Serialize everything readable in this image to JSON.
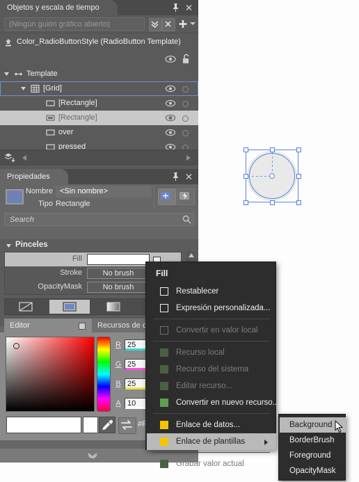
{
  "objects_panel": {
    "tab_label": "Objetos y escala de tiempo",
    "pin_icon": "pin-icon",
    "close_icon": "close-icon",
    "storyboard_field": "(Ningún guión gráfico abierto)",
    "storyboard_btn1": "collapse-all-icon",
    "storyboard_btn2": "close-storyboard-icon",
    "storyboard_plus": "plus-icon",
    "storyboard_caret": "chevron-down-icon",
    "root_label": "Color_RadioButtonStyle (RadioButton Template)",
    "root_icon": "return-scope-icon",
    "header_eye_icon": "eye-icon",
    "header_lock_icon": "unlock-icon",
    "tree": [
      {
        "label": "Template",
        "icon": "template-icon",
        "indent": 20,
        "caret": true,
        "selected": false,
        "outlined": false,
        "eye": false
      },
      {
        "label": "[Grid]",
        "icon": "grid-icon",
        "indent": 44,
        "caret": true,
        "selected": false,
        "outlined": true,
        "eye": true
      },
      {
        "label": "[Rectangle]",
        "icon": "rect-icon",
        "indent": 66,
        "caret": false,
        "selected": false,
        "outlined": false,
        "eye": true
      },
      {
        "label": "[Rectangle]",
        "icon": "rect-filled-icon",
        "indent": 66,
        "caret": false,
        "selected": true,
        "outlined": false,
        "eye": true
      },
      {
        "label": "over",
        "icon": "rect-icon",
        "indent": 66,
        "caret": false,
        "selected": false,
        "outlined": false,
        "eye": true
      },
      {
        "label": "pressed",
        "icon": "rect-icon",
        "indent": 66,
        "caret": false,
        "selected": false,
        "outlined": false,
        "eye": true
      }
    ],
    "bottom_icon": "layers-down-icon",
    "bottom_arrow_left": "arrow-left-icon",
    "bottom_arrow_right": "arrow-right-icon"
  },
  "properties_panel": {
    "tab_label": "Propiedades",
    "pin_icon": "pin-icon",
    "close_icon": "close-icon",
    "name_label": "Nombre",
    "name_value": "<Sin nombre>",
    "type_label": "Tipo",
    "type_value": "Rectangle",
    "thumb_name": "element-thumbnail",
    "btn_a": "show-properties-icon",
    "btn_b": "show-events-icon",
    "search_placeholder": "Search",
    "search_value": "Search",
    "search_icon": "search-icon"
  },
  "brushes": {
    "section_title": "Pinceles",
    "caret_icon": "chevron-down-icon",
    "rows": [
      {
        "label": "Fill",
        "value": "",
        "style": "white",
        "marker": "advanced-options-white",
        "highlighted": true
      },
      {
        "label": "Stroke",
        "value": "No brush",
        "style": "nobrush",
        "marker": "advanced-options",
        "highlighted": false
      },
      {
        "label": "OpacityMask",
        "value": "No brush",
        "style": "nobrush",
        "marker": "advanced-options-dim",
        "highlighted": false
      }
    ],
    "brush_tabs": [
      {
        "name": "no-brush-tab",
        "active": false
      },
      {
        "name": "solid-color-tab",
        "active": true
      },
      {
        "name": "gradient-brush-tab",
        "active": false
      },
      {
        "name": "tile-brush-tab",
        "active": false
      }
    ],
    "scroll_up_icon": "scroll-up-arrow"
  },
  "editor": {
    "tab_editor": "Editor",
    "tab_resources": "Recursos de c",
    "editor_square_icon": "alpha-square-icon",
    "channels": [
      {
        "label": "R",
        "value": "25",
        "bar": "#35d6d6"
      },
      {
        "label": "G",
        "value": "25",
        "bar": "#ff4fe0"
      },
      {
        "label": "B",
        "value": "25",
        "bar": "#f0e33c"
      },
      {
        "label": "A",
        "value": "10",
        "bar": "#ffffff"
      }
    ],
    "hex_label": "#F",
    "swap_icon": "swap-colors-icon",
    "eyedropper_icon": "eyedropper-icon",
    "swatch_color": "#ffffff",
    "bottom_chevron_icon": "chevron-double-down-icon"
  },
  "canvas": {
    "artboard_name": "radiobutton-preview",
    "selection_name": "selection-adorner"
  },
  "context_menu": {
    "title": "Fill",
    "items": [
      {
        "label": "Restablecer",
        "marker": "checkbox",
        "disabled": false,
        "highlighted": false,
        "submenu": false,
        "sep_after": false
      },
      {
        "label": "Expresión personalizada...",
        "marker": "checkbox",
        "disabled": false,
        "highlighted": false,
        "submenu": false,
        "sep_after": true
      },
      {
        "label": "Convertir en valor local",
        "marker": "checkbox",
        "disabled": true,
        "highlighted": false,
        "submenu": false,
        "sep_after": true
      },
      {
        "label": "Recurso local",
        "marker": "green",
        "disabled": true,
        "highlighted": false,
        "submenu": false,
        "sep_after": false
      },
      {
        "label": "Recurso del sistema",
        "marker": "green",
        "disabled": true,
        "highlighted": false,
        "submenu": false,
        "sep_after": false
      },
      {
        "label": "Editar recurso...",
        "marker": "green",
        "disabled": true,
        "highlighted": false,
        "submenu": false,
        "sep_after": false
      },
      {
        "label": "Convertir en nuevo recurso...",
        "marker": "green",
        "disabled": false,
        "highlighted": false,
        "submenu": false,
        "sep_after": true
      },
      {
        "label": "Enlace de datos...",
        "marker": "yellow",
        "disabled": false,
        "highlighted": false,
        "submenu": false,
        "sep_after": false
      },
      {
        "label": "Enlace de plantillas",
        "marker": "yellow",
        "disabled": false,
        "highlighted": true,
        "submenu": true,
        "sep_after": true
      },
      {
        "label": "Grabar valor actual",
        "marker": "green",
        "disabled": true,
        "highlighted": false,
        "submenu": false,
        "sep_after": false
      }
    ]
  },
  "submenu": {
    "items": [
      {
        "label": "Background",
        "highlighted": true
      },
      {
        "label": "BorderBrush",
        "highlighted": false
      },
      {
        "label": "Foreground",
        "highlighted": false
      },
      {
        "label": "OpacityMask",
        "highlighted": false
      }
    ]
  },
  "cursor": {
    "name": "mouse-pointer"
  }
}
